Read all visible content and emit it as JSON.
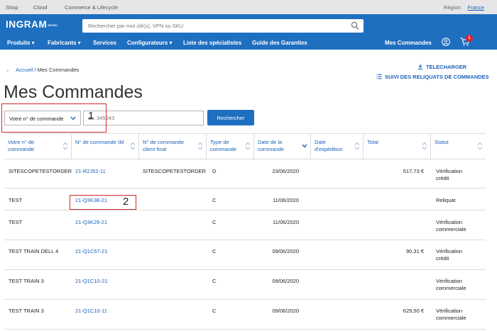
{
  "topbar": {
    "links": [
      {
        "label": "Shop",
        "name": "topbar-link-shop"
      },
      {
        "label": "Cloud",
        "name": "topbar-link-cloud"
      },
      {
        "label": "Commerce & Lifecycle",
        "name": "topbar-link-commerce-lifecycle"
      }
    ],
    "region_label": "Région:",
    "region_value": "France"
  },
  "header": {
    "logo_text": "INGRAM",
    "logo_sub": "MICRO",
    "search_placeholder": "Rechercher par mot clé(s), VPN ou SKU",
    "nav": [
      {
        "label": "Produits ▾",
        "name": "nav-produits"
      },
      {
        "label": "Fabricants ▾",
        "name": "nav-fabricants"
      },
      {
        "label": "Services",
        "name": "nav-services"
      },
      {
        "label": "Configurateurs ▾",
        "name": "nav-configurateurs"
      },
      {
        "label": "Liste des spécialistes",
        "name": "nav-liste-specialistes"
      },
      {
        "label": "Guide des Garanties",
        "name": "nav-guide-garanties"
      }
    ],
    "my_orders": "Mes Commandes",
    "cart_count": "1"
  },
  "breadcrumb": {
    "back_arrow": "←",
    "home": "Accueil",
    "separator": "/",
    "current": "Mes Commandes"
  },
  "actions": {
    "download": "TELECHARGER",
    "backorders": "SUIVI DES RELIQUATS DE COMMANDES"
  },
  "page_title": "Mes Commandes",
  "filter": {
    "select_value": "Votre n° de commande",
    "input_placeholder": "ex: 345643",
    "search_button": "Rechercher"
  },
  "annotations": {
    "first": "1",
    "second": "2"
  },
  "table": {
    "columns": [
      "Votre n° de\ncommande",
      "N° de commande IM",
      "N° de commande\nclient final",
      "Type de\ncommande",
      "Date de la\ncommande",
      "Date\nd'expédition",
      "Total",
      "Statut"
    ],
    "rows": [
      {
        "your_order": "SITESCOPETESTORDER",
        "im_order": "21-R2J52-11",
        "end_customer": "SITESCOPETESTORDER",
        "type": "D",
        "order_date": "23/06/2020",
        "ship_date": "",
        "total": "517,73 €",
        "status": "Vérification\ncrédit"
      },
      {
        "your_order": "TEST",
        "im_order": "21-Q3K38-21",
        "end_customer": "",
        "type": "C",
        "order_date": "11/06/2020",
        "ship_date": "",
        "total": "",
        "status": "Reliquat"
      },
      {
        "your_order": "TEST",
        "im_order": "21-Q3K29-21",
        "end_customer": "",
        "type": "C",
        "order_date": "11/06/2020",
        "ship_date": "",
        "total": "",
        "status": "Vérification\ncommerciale"
      },
      {
        "your_order": "TEST TRAIN DELL 4",
        "im_order": "21-Q1C57-21",
        "end_customer": "",
        "type": "C",
        "order_date": "09/06/2020",
        "ship_date": "",
        "total": "90,31 €",
        "status": "Vérification\ncrédit"
      },
      {
        "your_order": "TEST TRAIN 3",
        "im_order": "21-Q1C10-21",
        "end_customer": "",
        "type": "C",
        "order_date": "09/06/2020",
        "ship_date": "",
        "total": "",
        "status": "Vérification\ncommerciale"
      },
      {
        "your_order": "TEST TRAIN 3",
        "im_order": "21-Q1C10-11",
        "end_customer": "",
        "type": "C",
        "order_date": "09/06/2020",
        "ship_date": "",
        "total": "629,50 €",
        "status": "Vérification\ncommerciale"
      }
    ]
  },
  "colors": {
    "brand_blue": "#1f6fc0",
    "link_blue": "#1a62b8",
    "badge_red": "#e21a2c",
    "annotation_red": "#d02828"
  }
}
